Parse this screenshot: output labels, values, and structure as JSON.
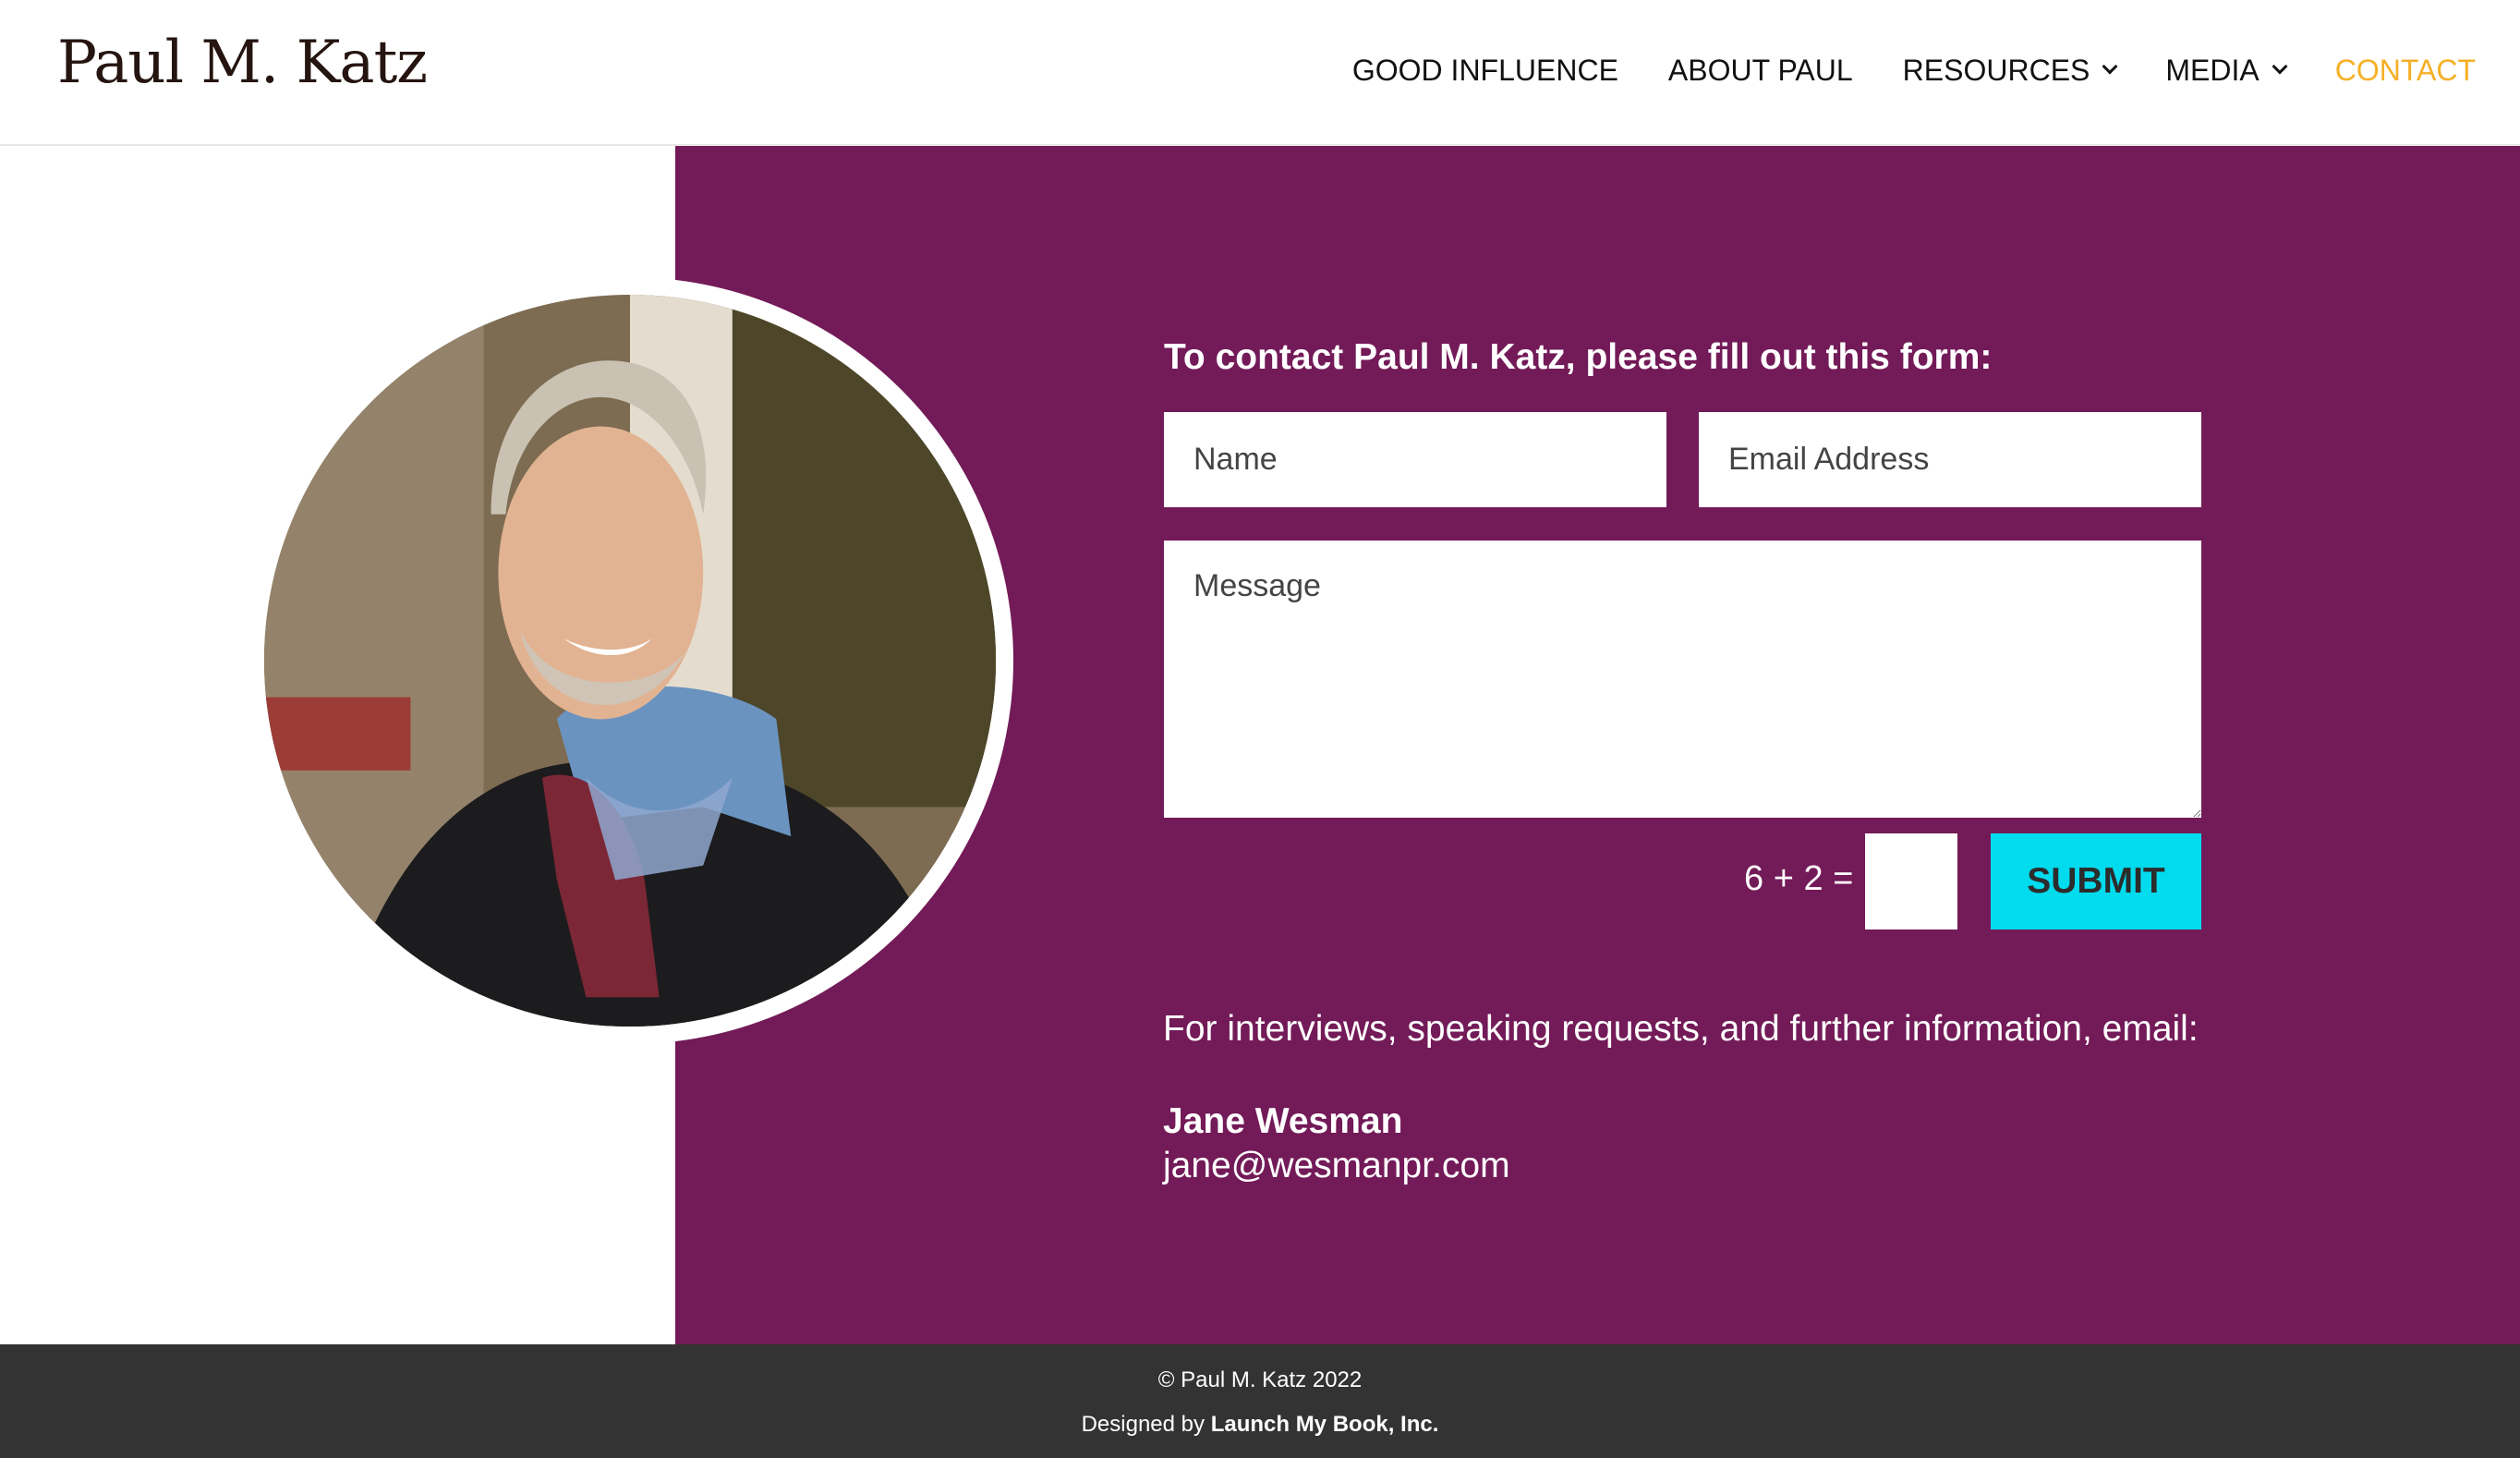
{
  "header": {
    "logo": "Paul M. Katz",
    "nav": [
      {
        "label": "GOOD INFLUENCE",
        "dropdown": false,
        "active": false
      },
      {
        "label": "ABOUT PAUL",
        "dropdown": false,
        "active": false
      },
      {
        "label": "RESOURCES",
        "dropdown": true,
        "active": false
      },
      {
        "label": "MEDIA",
        "dropdown": true,
        "active": false
      },
      {
        "label": "CONTACT",
        "dropdown": false,
        "active": true
      }
    ]
  },
  "portrait": {
    "alt": "Portrait of Paul M. Katz smiling outdoors, wearing a scarf and dark jacket"
  },
  "form": {
    "title": "To contact Paul M. Katz, please fill out this form:",
    "name_placeholder": "Name",
    "email_placeholder": "Email Address",
    "message_placeholder": "Message",
    "captcha_label": "6 + 2 =",
    "captcha_value": "",
    "submit_label": "SUBMIT"
  },
  "info": {
    "text": "For interviews, speaking requests, and further information, email:",
    "contact_name": "Jane Wesman",
    "contact_email": "jane@wesmanpr.com"
  },
  "footer": {
    "copyright": "© Paul M. Katz 2022",
    "designed_prefix": "Designed by ",
    "designed_by": "Launch My Book, Inc."
  },
  "colors": {
    "brand_purple": "#731a58",
    "active_nav": "#f5b026",
    "submit_cyan": "#00dbed",
    "footer_bg": "#333333"
  }
}
